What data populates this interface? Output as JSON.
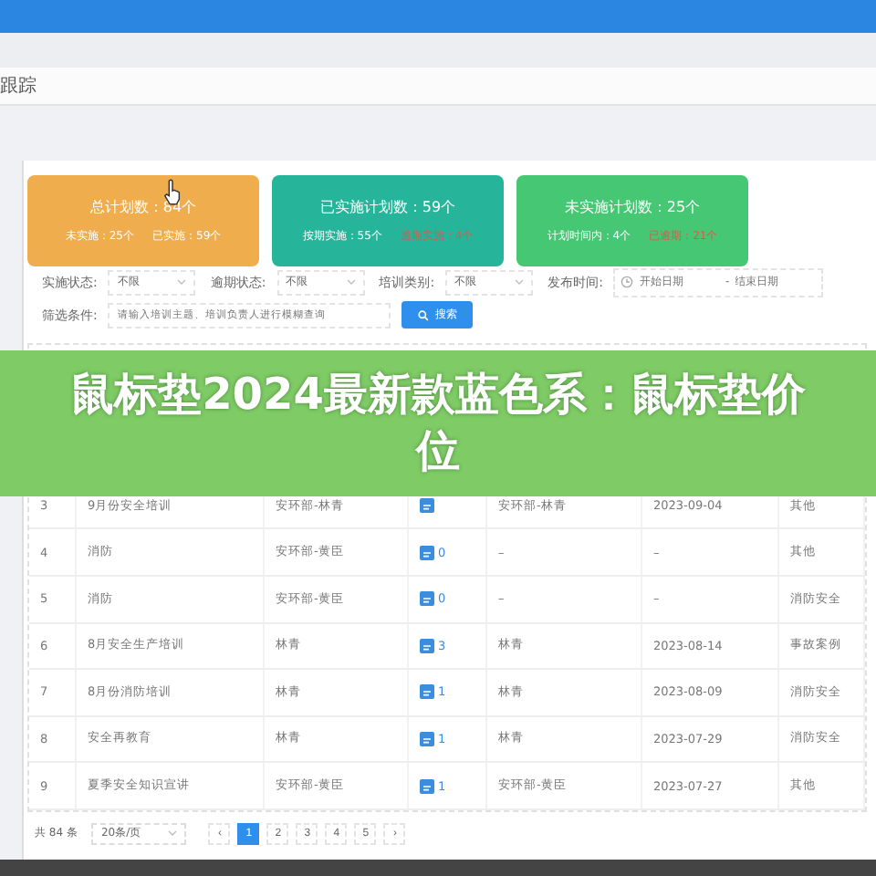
{
  "page_title": "跟踪",
  "summary_cards": [
    {
      "color": "#f0ad4e",
      "title": "总计划数：84个",
      "stats": [
        {
          "label": "未实施：25个",
          "alert": false
        },
        {
          "label": "已实施：59个",
          "alert": false
        }
      ]
    },
    {
      "color": "#26b59a",
      "title": "已实施计划数：59个",
      "stats": [
        {
          "label": "按期实施：55个",
          "alert": false
        },
        {
          "label": "逾期实施：4个",
          "alert": true
        }
      ]
    },
    {
      "color": "#45c774",
      "title": "未实施计划数：25个",
      "stats": [
        {
          "label": "计划时间内：4个",
          "alert": false
        },
        {
          "label": "已逾期：21个",
          "alert": true
        }
      ]
    }
  ],
  "filters": [
    {
      "label": "实施状态:",
      "value": "不限"
    },
    {
      "label": "逾期状态:",
      "value": "不限"
    },
    {
      "label": "培训类别:",
      "value": "不限"
    }
  ],
  "date_filter": {
    "label": "发布时间:",
    "start_placeholder": "开始日期",
    "separator": "-",
    "end_placeholder": "结束日期"
  },
  "condition": {
    "label": "筛选条件:",
    "placeholder": "请输入培训主题、培训负责人进行模糊查询"
  },
  "search_button": "搜索",
  "table": {
    "rows": [
      {
        "index": "3",
        "topic": "9月份安全培训",
        "owner": "安环部-林青",
        "progress": null,
        "implementer": "安环部-林青",
        "date": "2023-09-04",
        "category": "其他"
      },
      {
        "index": "4",
        "topic": "消防",
        "owner": "安环部-黄臣",
        "progress": "0",
        "implementer": "–",
        "date": "–",
        "category": "其他"
      },
      {
        "index": "5",
        "topic": "消防",
        "owner": "安环部-黄臣",
        "progress": "0",
        "implementer": "–",
        "date": "–",
        "category": "消防安全"
      },
      {
        "index": "6",
        "topic": "8月安全生产培训",
        "owner": "林青",
        "progress": "3",
        "implementer": "林青",
        "date": "2023-08-14",
        "category": "事故案例"
      },
      {
        "index": "7",
        "topic": "8月份消防培训",
        "owner": "林青",
        "progress": "1",
        "implementer": "林青",
        "date": "2023-08-09",
        "category": "消防安全"
      },
      {
        "index": "8",
        "topic": "安全再教育",
        "owner": "林青",
        "progress": "1",
        "implementer": "林青",
        "date": "2023-07-29",
        "category": "消防安全"
      },
      {
        "index": "9",
        "topic": "夏季安全知识宣讲",
        "owner": "安环部-黄臣",
        "progress": "1",
        "implementer": "安环部-黄臣",
        "date": "2023-07-27",
        "category": "其他"
      }
    ]
  },
  "pagination": {
    "total": "共 84 条",
    "page_size": "20条/页",
    "prev": "‹",
    "next": "›",
    "pages": [
      {
        "label": "1",
        "selected": true
      },
      {
        "label": "2",
        "selected": false
      },
      {
        "label": "3",
        "selected": false
      },
      {
        "label": "4",
        "selected": false
      },
      {
        "label": "5",
        "selected": false
      }
    ]
  },
  "overlay_caption": "鼠标垫2024最新款蓝色系：鼠标垫价位"
}
